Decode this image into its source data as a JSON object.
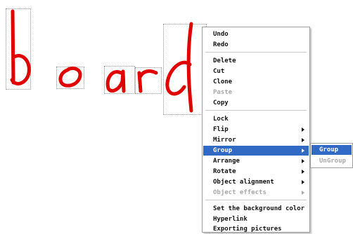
{
  "canvas": {
    "ink_color": "#e00000",
    "handwritten_word": "board"
  },
  "context_menu": {
    "items": [
      {
        "label": "Undo",
        "enabled": true
      },
      {
        "label": "Redo",
        "enabled": true
      },
      {
        "label": "Delete",
        "enabled": true
      },
      {
        "label": "Cut",
        "enabled": true
      },
      {
        "label": "Clone",
        "enabled": true
      },
      {
        "label": "Paste",
        "enabled": false
      },
      {
        "label": "Copy",
        "enabled": true
      },
      {
        "label": "Lock",
        "enabled": true
      },
      {
        "label": "Flip",
        "enabled": true,
        "submenu": true
      },
      {
        "label": "Mirror",
        "enabled": true,
        "submenu": true
      },
      {
        "label": "Group",
        "enabled": true,
        "submenu": true,
        "highlighted": true
      },
      {
        "label": "Arrange",
        "enabled": true,
        "submenu": true
      },
      {
        "label": "Rotate",
        "enabled": true,
        "submenu": true
      },
      {
        "label": "Object alignment",
        "enabled": true,
        "submenu": true
      },
      {
        "label": "Object effects",
        "enabled": false,
        "submenu": true
      },
      {
        "label": "Set the background color",
        "enabled": true
      },
      {
        "label": "Hyperlink",
        "enabled": true
      },
      {
        "label": "Exporting pictures",
        "enabled": true
      }
    ],
    "highlight_color": "#316ac5"
  },
  "group_submenu": {
    "items": [
      {
        "label": "Group",
        "enabled": true,
        "highlighted": true
      },
      {
        "label": "UnGroup",
        "enabled": false
      }
    ]
  }
}
